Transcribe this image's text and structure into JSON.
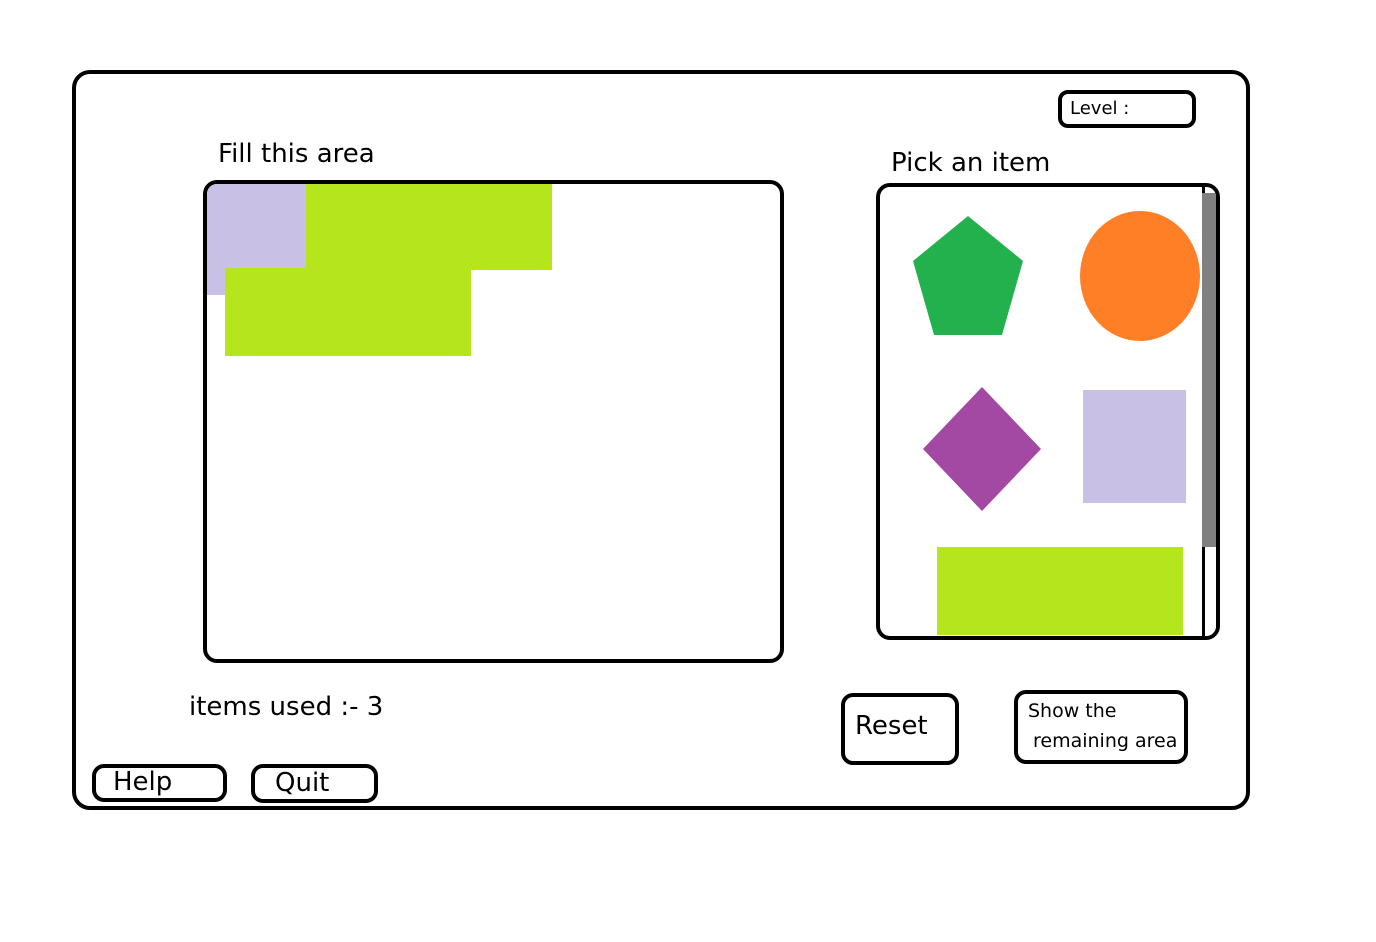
{
  "level": {
    "label": "Level :",
    "value": ""
  },
  "fill_area": {
    "title": "Fill this area",
    "placed_items": [
      {
        "shape": "square",
        "color": "#c8c1e5"
      },
      {
        "shape": "rectangle",
        "color": "#b5e61d"
      },
      {
        "shape": "rectangle",
        "color": "#b5e61d"
      }
    ]
  },
  "picker": {
    "title": "Pick an item",
    "items": [
      {
        "shape": "pentagon",
        "color": "#22b14c"
      },
      {
        "shape": "circle",
        "color": "#ff7f27"
      },
      {
        "shape": "diamond",
        "color": "#a349a4"
      },
      {
        "shape": "square",
        "color": "#c8c1e5"
      },
      {
        "shape": "rectangle",
        "color": "#b5e61d"
      }
    ]
  },
  "status": {
    "items_used": "items used :- 3"
  },
  "buttons": {
    "reset": "Reset",
    "show_remaining_line1": "Show the",
    "show_remaining_line2": "remaining area",
    "help": "Help",
    "quit": "Quit"
  }
}
